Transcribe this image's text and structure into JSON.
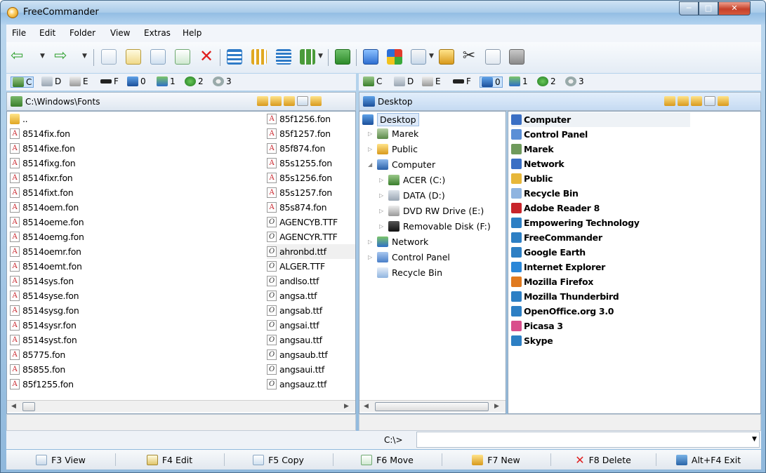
{
  "window": {
    "title": "FreeCommander"
  },
  "menu": [
    "File",
    "Edit",
    "Folder",
    "View",
    "Extras",
    "Help"
  ],
  "drives": [
    {
      "label": "C",
      "icon": "hard-drive-icon"
    },
    {
      "label": "D",
      "icon": "data-drive-icon"
    },
    {
      "label": "E",
      "icon": "dvd-drive-icon"
    },
    {
      "label": "F",
      "icon": "removable-disk-icon"
    },
    {
      "label": "0",
      "icon": "desktop-icon"
    },
    {
      "label": "1",
      "icon": "network-icon"
    },
    {
      "label": "2",
      "icon": "ftp-icon"
    },
    {
      "label": "3",
      "icon": "gear-icon"
    }
  ],
  "left_panel": {
    "path": "C:\\Windows\\Fonts",
    "col1": [
      "..",
      "8514fix.fon",
      "8514fixe.fon",
      "8514fixg.fon",
      "8514fixr.fon",
      "8514fixt.fon",
      "8514oem.fon",
      "8514oeme.fon",
      "8514oemg.fon",
      "8514oemr.fon",
      "8514oemt.fon",
      "8514sys.fon",
      "8514syse.fon",
      "8514sysg.fon",
      "8514sysr.fon",
      "8514syst.fon",
      "85775.fon",
      "85855.fon",
      "85f1255.fon"
    ],
    "col2": [
      "85f1256.fon",
      "85f1257.fon",
      "85f874.fon",
      "85s1255.fon",
      "85s1256.fon",
      "85s1257.fon",
      "85s874.fon",
      "AGENCYB.TTF",
      "AGENCYR.TTF",
      "ahronbd.ttf",
      "ALGER.TTF",
      "andlso.ttf",
      "angsa.ttf",
      "angsab.ttf",
      "angsai.ttf",
      "angsau.ttf",
      "angsaub.ttf",
      "angsaui.ttf",
      "angsauz.ttf"
    ]
  },
  "right_panel": {
    "path": "Desktop",
    "tree": [
      {
        "label": "Desktop",
        "depth": 0,
        "icon": "desktop-icon",
        "exp": ""
      },
      {
        "label": "Marek",
        "depth": 1,
        "icon": "user-folder-icon",
        "exp": "▷"
      },
      {
        "label": "Public",
        "depth": 1,
        "icon": "folder-icon",
        "exp": "▷"
      },
      {
        "label": "Computer",
        "depth": 1,
        "icon": "computer-icon",
        "exp": "◢"
      },
      {
        "label": "ACER (C:)",
        "depth": 2,
        "icon": "hard-drive-icon",
        "exp": "▷"
      },
      {
        "label": "DATA (D:)",
        "depth": 2,
        "icon": "data-drive-icon",
        "exp": "▷"
      },
      {
        "label": "DVD RW Drive (E:)",
        "depth": 2,
        "icon": "dvd-drive-icon",
        "exp": "▷"
      },
      {
        "label": "Removable Disk (F:)",
        "depth": 2,
        "icon": "removable-disk-icon",
        "exp": "▷"
      },
      {
        "label": "Network",
        "depth": 1,
        "icon": "network-icon",
        "exp": "▷"
      },
      {
        "label": "Control Panel",
        "depth": 1,
        "icon": "control-panel-icon",
        "exp": "▷"
      },
      {
        "label": "Recycle Bin",
        "depth": 1,
        "icon": "recycle-bin-icon",
        "exp": ""
      }
    ],
    "items": [
      {
        "label": "Computer",
        "color": "#3a6fc4"
      },
      {
        "label": "Control Panel",
        "color": "#5b8fd6"
      },
      {
        "label": "Marek",
        "color": "#6f9a5c"
      },
      {
        "label": "Network",
        "color": "#3a6fc4"
      },
      {
        "label": "Public",
        "color": "#e7b73a"
      },
      {
        "label": "Recycle Bin",
        "color": "#8fb4e0"
      },
      {
        "label": "Adobe Reader 8",
        "color": "#c8242b"
      },
      {
        "label": "Empowering Technology",
        "color": "#2d7fc4"
      },
      {
        "label": "FreeCommander",
        "color": "#2d7fc4"
      },
      {
        "label": "Google Earth",
        "color": "#2d7fc4"
      },
      {
        "label": "Internet Explorer",
        "color": "#2a87d8"
      },
      {
        "label": "Mozilla Firefox",
        "color": "#e07a1f"
      },
      {
        "label": "Mozilla Thunderbird",
        "color": "#2d7fc4"
      },
      {
        "label": "OpenOffice.org 3.0",
        "color": "#2d7fc4"
      },
      {
        "label": "Picasa 3",
        "color": "#d94f8c"
      },
      {
        "label": "Skype",
        "color": "#2d7fc4"
      }
    ]
  },
  "command": {
    "label": "C:\\>",
    "value": ""
  },
  "fkeys": [
    {
      "label": "F3 View",
      "icon": "view-icon"
    },
    {
      "label": "F4 Edit",
      "icon": "edit-icon"
    },
    {
      "label": "F5 Copy",
      "icon": "copy-icon"
    },
    {
      "label": "F6 Move",
      "icon": "move-icon"
    },
    {
      "label": "F7 New",
      "icon": "new-folder-icon"
    },
    {
      "label": "F8 Delete",
      "icon": "delete-icon"
    },
    {
      "label": "Alt+F4 Exit",
      "icon": "exit-icon"
    }
  ]
}
